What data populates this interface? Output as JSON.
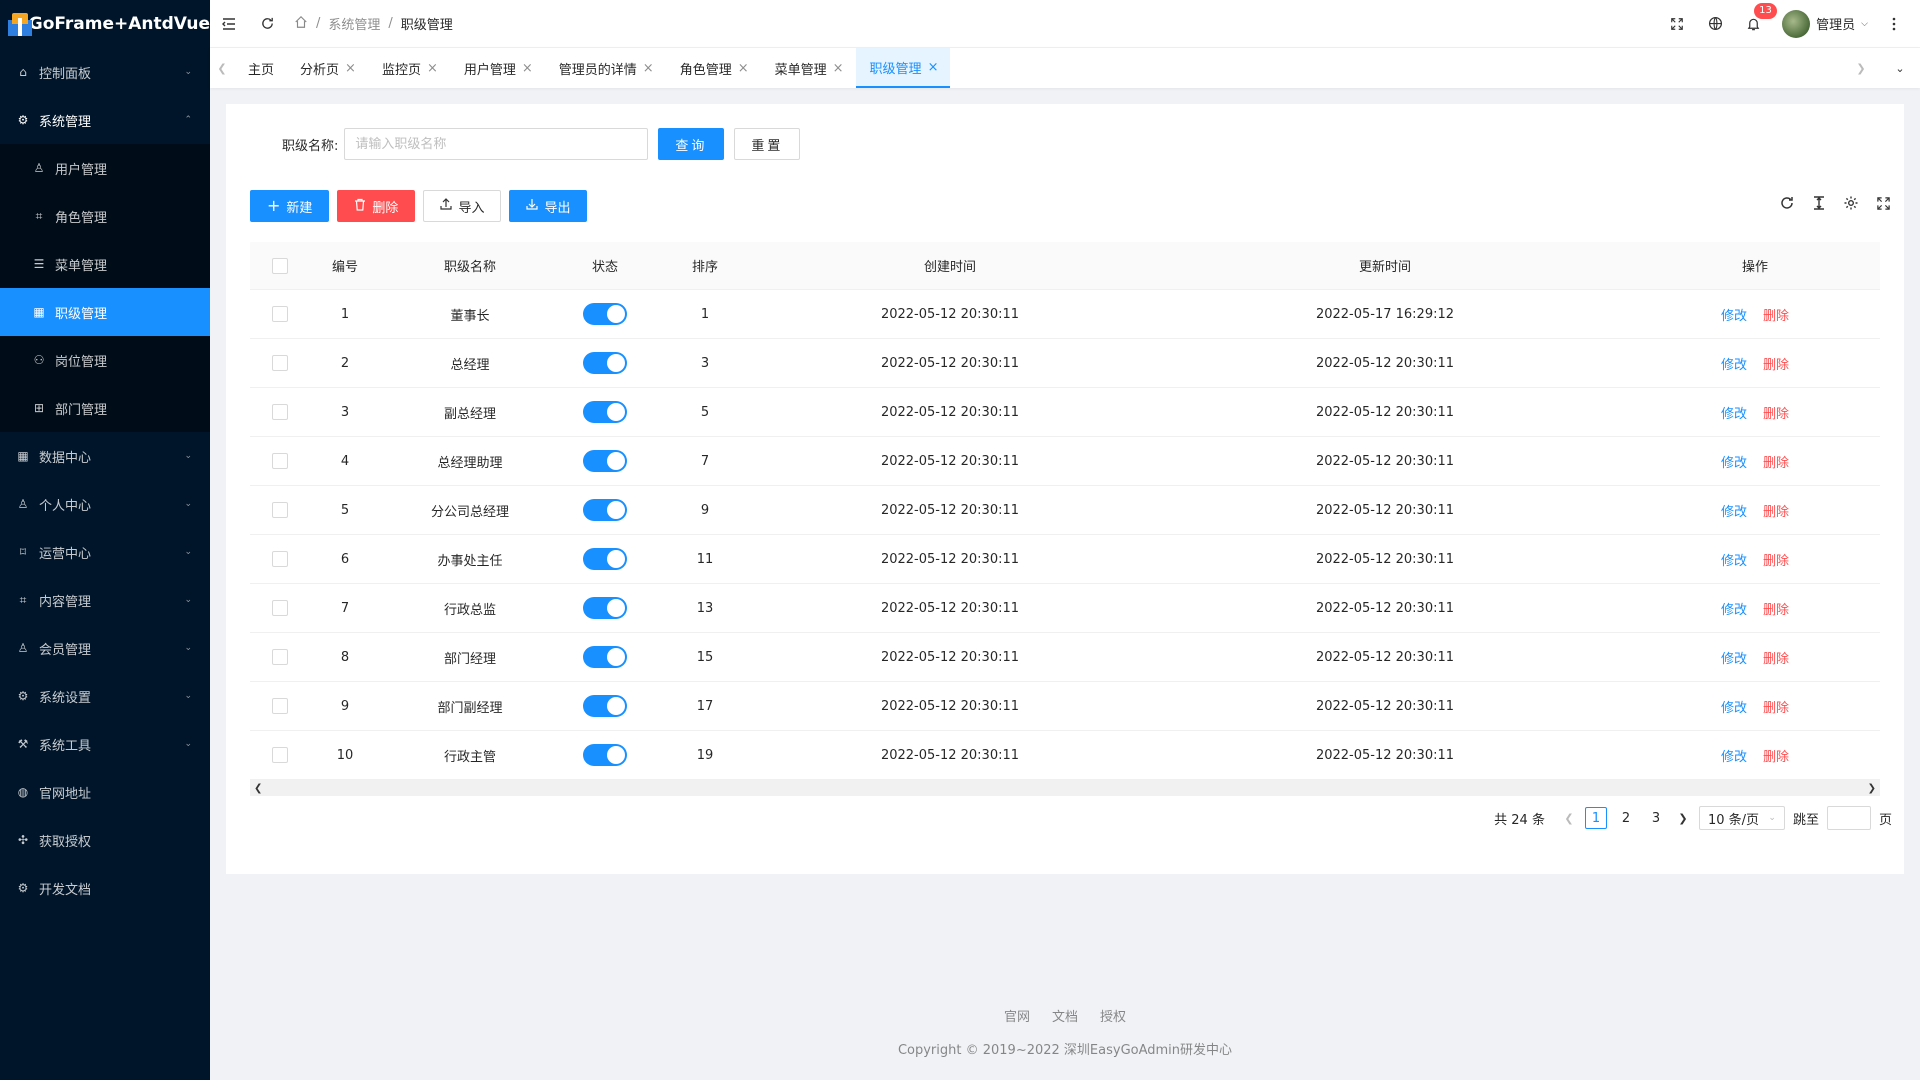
{
  "app": {
    "title": "GoFrame+AntdVue"
  },
  "sidebar": {
    "items": [
      {
        "label": "控制面板",
        "icon": "home-icon",
        "glyph": "⌂",
        "chevron": "down"
      },
      {
        "label": "系统管理",
        "icon": "gear-icon",
        "glyph": "⚙",
        "chevron": "up",
        "open": true,
        "children": [
          {
            "label": "用户管理",
            "icon": "users-icon",
            "glyph": "♙"
          },
          {
            "label": "角色管理",
            "icon": "scan-icon",
            "glyph": "⌗"
          },
          {
            "label": "菜单管理",
            "icon": "menu-list-icon",
            "glyph": "☰"
          },
          {
            "label": "职级管理",
            "icon": "grid-icon",
            "glyph": "▦",
            "active": true
          },
          {
            "label": "岗位管理",
            "icon": "cluster-icon",
            "glyph": "⚇"
          },
          {
            "label": "部门管理",
            "icon": "org-chart-icon",
            "glyph": "⊞"
          }
        ]
      },
      {
        "label": "数据中心",
        "icon": "dashboard-icon",
        "glyph": "▦",
        "chevron": "down"
      },
      {
        "label": "个人中心",
        "icon": "user-icon",
        "glyph": "♙",
        "chevron": "down"
      },
      {
        "label": "运营中心",
        "icon": "ops-icon",
        "glyph": "⌑",
        "chevron": "down"
      },
      {
        "label": "内容管理",
        "icon": "content-icon",
        "glyph": "⌗",
        "chevron": "down"
      },
      {
        "label": "会员管理",
        "icon": "member-icon",
        "glyph": "♙",
        "chevron": "down"
      },
      {
        "label": "系统设置",
        "icon": "settings-icon",
        "glyph": "⚙",
        "chevron": "down"
      },
      {
        "label": "系统工具",
        "icon": "tool-icon",
        "glyph": "⚒",
        "chevron": "down"
      },
      {
        "label": "官网地址",
        "icon": "globe-icon",
        "glyph": "◍"
      },
      {
        "label": "获取授权",
        "icon": "auth-icon",
        "glyph": "✣"
      },
      {
        "label": "开发文档",
        "icon": "docs-icon",
        "glyph": "⚙"
      }
    ]
  },
  "header": {
    "breadcrumb": [
      "系统管理",
      "职级管理"
    ],
    "notification_count": "13",
    "user_name": "管理员"
  },
  "tabs": [
    {
      "label": "主页",
      "closable": false
    },
    {
      "label": "分析页",
      "closable": true
    },
    {
      "label": "监控页",
      "closable": true
    },
    {
      "label": "用户管理",
      "closable": true
    },
    {
      "label": "管理员的详情",
      "closable": true
    },
    {
      "label": "角色管理",
      "closable": true
    },
    {
      "label": "菜单管理",
      "closable": true
    },
    {
      "label": "职级管理",
      "closable": true,
      "active": true
    }
  ],
  "search": {
    "label": "职级名称:",
    "placeholder": "请输入职级名称",
    "value": "",
    "query_label": "查询",
    "reset_label": "重置"
  },
  "toolbar": {
    "new_label": "新建",
    "delete_label": "删除",
    "import_label": "导入",
    "export_label": "导出"
  },
  "table": {
    "columns": [
      "编号",
      "职级名称",
      "状态",
      "排序",
      "创建时间",
      "更新时间",
      "操作"
    ],
    "edit_label": "修改",
    "delete_label": "删除",
    "rows": [
      {
        "id": "1",
        "name": "董事长",
        "status_on": true,
        "sort": "1",
        "created": "2022-05-12 20:30:11",
        "updated": "2022-05-17 16:29:12"
      },
      {
        "id": "2",
        "name": "总经理",
        "status_on": true,
        "sort": "3",
        "created": "2022-05-12 20:30:11",
        "updated": "2022-05-12 20:30:11"
      },
      {
        "id": "3",
        "name": "副总经理",
        "status_on": true,
        "sort": "5",
        "created": "2022-05-12 20:30:11",
        "updated": "2022-05-12 20:30:11"
      },
      {
        "id": "4",
        "name": "总经理助理",
        "status_on": true,
        "sort": "7",
        "created": "2022-05-12 20:30:11",
        "updated": "2022-05-12 20:30:11"
      },
      {
        "id": "5",
        "name": "分公司总经理",
        "status_on": true,
        "sort": "9",
        "created": "2022-05-12 20:30:11",
        "updated": "2022-05-12 20:30:11"
      },
      {
        "id": "6",
        "name": "办事处主任",
        "status_on": true,
        "sort": "11",
        "created": "2022-05-12 20:30:11",
        "updated": "2022-05-12 20:30:11"
      },
      {
        "id": "7",
        "name": "行政总监",
        "status_on": true,
        "sort": "13",
        "created": "2022-05-12 20:30:11",
        "updated": "2022-05-12 20:30:11"
      },
      {
        "id": "8",
        "name": "部门经理",
        "status_on": true,
        "sort": "15",
        "created": "2022-05-12 20:30:11",
        "updated": "2022-05-12 20:30:11"
      },
      {
        "id": "9",
        "name": "部门副经理",
        "status_on": true,
        "sort": "17",
        "created": "2022-05-12 20:30:11",
        "updated": "2022-05-12 20:30:11"
      },
      {
        "id": "10",
        "name": "行政主管",
        "status_on": true,
        "sort": "19",
        "created": "2022-05-12 20:30:11",
        "updated": "2022-05-12 20:30:11"
      }
    ]
  },
  "pagination": {
    "total_text": "共 24 条",
    "pages": [
      "1",
      "2",
      "3"
    ],
    "current": "1",
    "page_size": "10 条/页",
    "jump_label": "跳至",
    "page_suffix": "页"
  },
  "footer": {
    "links": [
      "官网",
      "文档",
      "授权"
    ],
    "copyright": "Copyright © 2019~2022 深圳EasyGoAdmin研发中心"
  },
  "colors": {
    "primary": "#1890ff",
    "danger": "#ff4d4f",
    "sider": "#001529"
  }
}
